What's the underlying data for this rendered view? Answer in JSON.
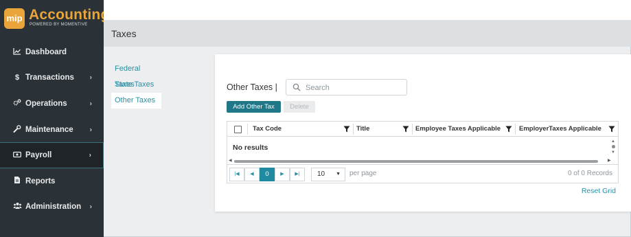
{
  "brand": {
    "badge": "mip",
    "title": "Accounting",
    "subtitle": "POWERED BY MOMENTIVE",
    "accent_color": "#e9a53a"
  },
  "sidebar": {
    "items": [
      {
        "label": "Dashboard",
        "icon": "chart-line-icon",
        "has_submenu": false
      },
      {
        "label": "Transactions",
        "icon": "dollar-icon",
        "has_submenu": true
      },
      {
        "label": "Operations",
        "icon": "gears-icon",
        "has_submenu": true
      },
      {
        "label": "Maintenance",
        "icon": "wrench-icon",
        "has_submenu": true
      },
      {
        "label": "Payroll",
        "icon": "money-icon",
        "has_submenu": true,
        "active": true
      },
      {
        "label": "Reports",
        "icon": "document-icon",
        "has_submenu": false
      },
      {
        "label": "Administration",
        "icon": "users-icon",
        "has_submenu": true
      }
    ]
  },
  "page": {
    "title": "Taxes"
  },
  "submenu": {
    "items": [
      "Federal Taxes",
      "State Taxes",
      "Other Taxes"
    ],
    "selected": "Other Taxes"
  },
  "section": {
    "title": "Other Taxes |",
    "search_placeholder": "Search",
    "add_button": "Add Other Tax",
    "delete_button": "Delete"
  },
  "grid": {
    "columns": [
      "Tax Code",
      "Title",
      "Employee Taxes Applicable",
      "EmployerTaxes Applicable"
    ],
    "empty_message": "No results",
    "pager": {
      "current_page": "0",
      "per_page": "10",
      "per_page_label": "per page",
      "records": "0 of 0 Records"
    },
    "reset_label": "Reset Grid"
  },
  "colors": {
    "primary": "#1f7787",
    "link": "#2a8fa3",
    "sidebar_bg": "#2b3237"
  }
}
